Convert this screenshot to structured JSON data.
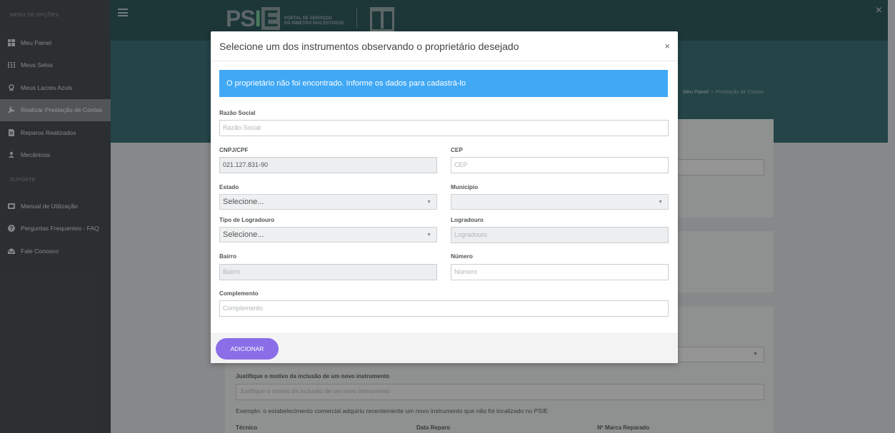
{
  "sidebar": {
    "menu_heading": "MENU DE OPÇÕES",
    "items": [
      {
        "label": "Meu Painel",
        "icon": "dashboard-icon"
      },
      {
        "label": "Meus Selos",
        "icon": "grid-icon"
      },
      {
        "label": "Meus Lacres Azuis",
        "icon": "seal-icon"
      },
      {
        "label": "Realizar Prestação de Contas",
        "icon": "wrench-icon",
        "active": true
      },
      {
        "label": "Reparos Realizados",
        "icon": "document-icon"
      },
      {
        "label": "Mecânicos",
        "icon": "user-icon"
      }
    ],
    "support_heading": "SUPORTE",
    "support_items": [
      {
        "label": "Manual de Utilização",
        "icon": "book-icon"
      },
      {
        "label": "Perguntas Frequentes - FAQ",
        "icon": "question-icon"
      },
      {
        "label": "Fale Conosco",
        "icon": "mail-icon"
      }
    ]
  },
  "header": {
    "logo_text": "PSIE",
    "portal_line1": "PORTAL DE SERVIÇOS",
    "portal_line2": "DO INMETRO NOS ESTADOS",
    "inmetro_text": "INMETRO"
  },
  "breadcrumb": {
    "home": "Meu Painel",
    "separator": ">",
    "current": "Prestação de Contas"
  },
  "background_form": {
    "justify_label": "Justifique o motivo da inclusão de um novo instrumento",
    "justify_placeholder": "Justifique o motivo da inclusão de um novo instrumento",
    "example_text": "Exemplo: o estabelecimento comercial adquiriu recentemente um novo instrumento que não foi localizado no PSIE",
    "col_tecnico": "Técnico",
    "col_data": "Data Reparo",
    "col_marca": "Nº Marca Reparado"
  },
  "modal": {
    "title": "Selecione um dos instrumentos observando o proprietário desejado",
    "close": "×",
    "alert": "O proprietário não foi encontrado. Informe os dados para cadastrá-lo",
    "fields": {
      "razao_label": "Razão Social",
      "razao_placeholder": "Razão Social",
      "cnpj_label": "CNPJ/CPF",
      "cnpj_value": "021.127.831-90",
      "cep_label": "CEP",
      "cep_placeholder": "CEP",
      "estado_label": "Estado",
      "estado_value": "Selecione...",
      "municipio_label": "Município",
      "municipio_value": "",
      "tipo_label": "Tipo de Logradouro",
      "tipo_value": "Selecione...",
      "logradouro_label": "Logradouro",
      "logradouro_placeholder": "Logradouro",
      "bairro_label": "Bairro",
      "bairro_placeholder": "Bairro",
      "numero_label": "Número",
      "numero_placeholder": "Número",
      "complemento_label": "Complemento",
      "complemento_placeholder": "Complemento"
    },
    "add_button": "ADICIONAR"
  },
  "page_close": "×",
  "colors": {
    "sidebar_bg": "#4b5257",
    "header_bg": "#335f63",
    "alert_bg": "#40a8f5",
    "button_bg": "#8a6ee8"
  }
}
